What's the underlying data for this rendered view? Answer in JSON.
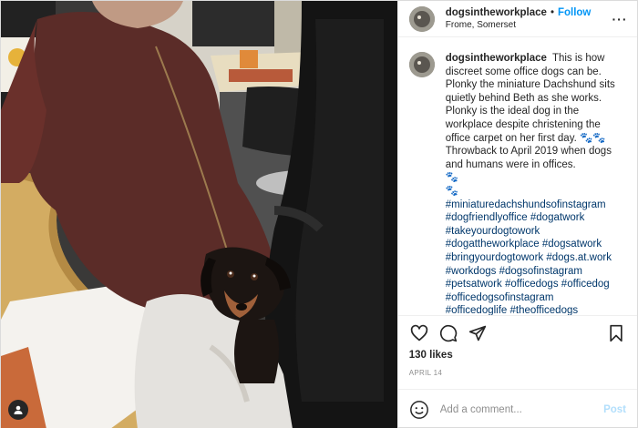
{
  "post": {
    "username": "dogsintheworkplace",
    "follow_label": "Follow",
    "separator": "•",
    "location": "Frome, Somerset",
    "more_label": "···",
    "caption": {
      "username": "dogsintheworkplace",
      "text": "This is how discreet some office dogs can be. Plonky the miniature Dachshund sits quietly behind Beth as she works. Plonky is the ideal dog in the workplace despite christening the office carpet on her first day. 🐾🐾 Throwback to April 2019 when dogs and humans were in offices.\n🐾\n🐾",
      "hashtags": [
        "#miniaturedachshundsofinstagram",
        "#dogfriendlyoffice",
        "#dogatwork",
        "#takeyourdogtowork",
        "#dogattheworkplace",
        "#dogsatwork",
        "#bringyourdogtowork",
        "#dogs.at.work",
        "#workdogs",
        "#dogsofinstagram",
        "#petsatwork",
        "#officedogs",
        "#officedog",
        "#officedogsofinstagram",
        "#officedoglife",
        "#theofficedogs"
      ]
    },
    "likes": "130 likes",
    "date": "APRIL 14",
    "comment": {
      "placeholder": "Add a comment...",
      "post_label": "Post"
    },
    "icons": {
      "like": "heart-icon",
      "comment": "comment-icon",
      "share": "share-icon",
      "save": "bookmark-icon",
      "emoji": "emoji-icon",
      "user_tag": "user-tag-icon"
    },
    "colors": {
      "link": "#00376b",
      "follow": "#0095f6",
      "post_disabled": "#b2dffc",
      "muted": "#8e8e8e"
    }
  }
}
